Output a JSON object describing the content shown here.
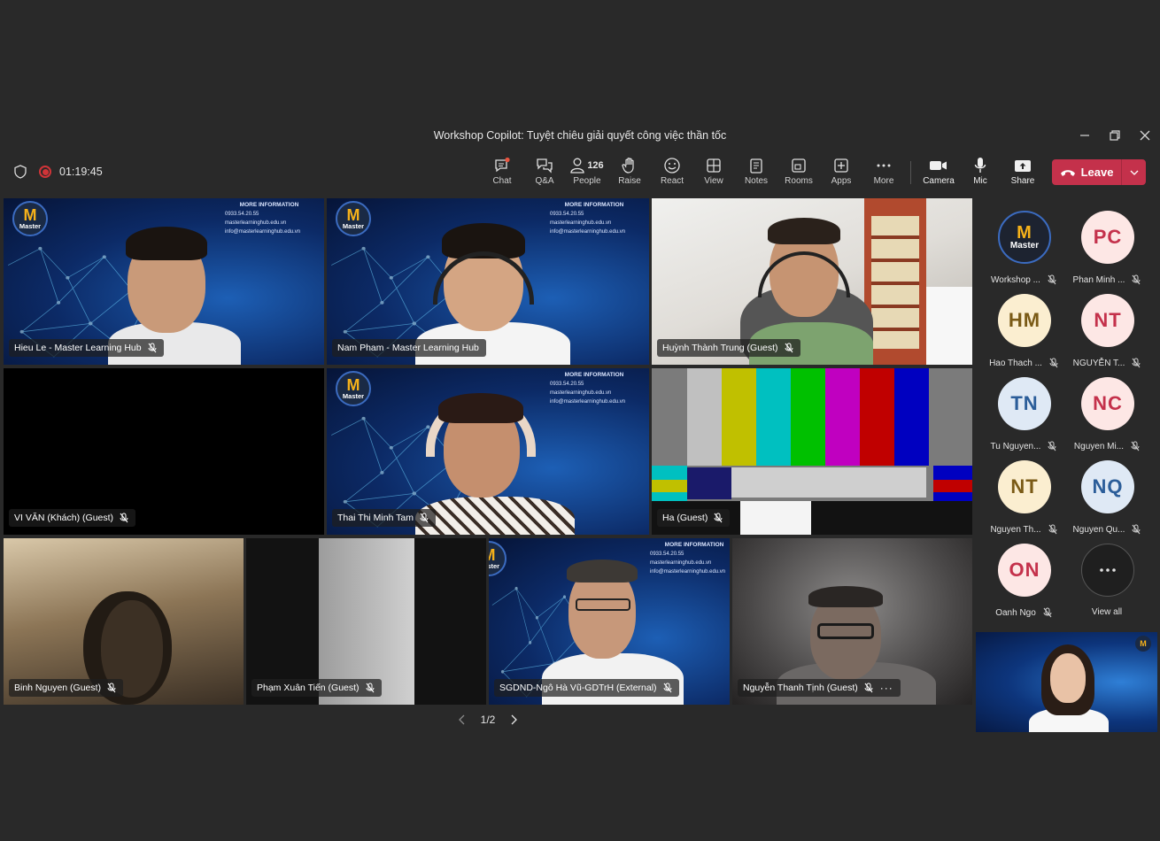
{
  "window": {
    "title": "Workshop Copilot: Tuyệt chiêu giải quyết công việc thần tốc"
  },
  "meeting": {
    "elapsed": "01:19:45"
  },
  "toolbar": {
    "chat": "Chat",
    "qa": "Q&A",
    "people": "People",
    "people_count": "126",
    "raise": "Raise",
    "react": "React",
    "view": "View",
    "notes": "Notes",
    "rooms": "Rooms",
    "apps": "Apps",
    "more": "More",
    "camera": "Camera",
    "mic": "Mic",
    "share": "Share",
    "leave": "Leave"
  },
  "background_card": {
    "title": "MORE INFORMATION",
    "phone": "0933.54.20.55",
    "web": "masterlearninghub.edu.vn",
    "email": "info@masterlearninghub.edu.vn",
    "logo_letter": "M",
    "logo_text": "Master"
  },
  "tiles": [
    {
      "name": "Hieu Le - Master Learning Hub"
    },
    {
      "name": "Nam Pham - Master Learning Hub"
    },
    {
      "name": "Huỳnh Thành Trung (Guest)"
    },
    {
      "name": "VI VĂN (Khách) (Guest)"
    },
    {
      "name": "Thai Thi Minh Tam"
    },
    {
      "name": "Ha (Guest)"
    },
    {
      "name": "Binh Nguyen (Guest)"
    },
    {
      "name": "Phạm Xuân Tiến (Guest)"
    },
    {
      "name": "SGDND-Ngô Hà Vũ-GDTrH (External)"
    },
    {
      "name": "Nguyễn Thanh Tịnh (Guest)"
    }
  ],
  "pager": {
    "label": "1/2"
  },
  "roster": [
    {
      "initials": "",
      "name": "Workshop ...",
      "bg": "#1d2330",
      "fg": "#ffffff"
    },
    {
      "initials": "PC",
      "name": "Phan Minh ...",
      "bg": "#fde7e5",
      "fg": "#c4314b"
    },
    {
      "initials": "HM",
      "name": "Hao Thach ...",
      "bg": "#fbeed0",
      "fg": "#7a5a16"
    },
    {
      "initials": "NT",
      "name": "NGUYỄN T...",
      "bg": "#fde7e5",
      "fg": "#c4314b"
    },
    {
      "initials": "TN",
      "name": "Tu Nguyen...",
      "bg": "#dfe9f5",
      "fg": "#2b5d99"
    },
    {
      "initials": "NC",
      "name": "Nguyen Mi...",
      "bg": "#fde7e5",
      "fg": "#c4314b"
    },
    {
      "initials": "NT",
      "name": "Nguyen Th...",
      "bg": "#fbeed0",
      "fg": "#7a5a16"
    },
    {
      "initials": "NQ",
      "name": "Nguyen Qu...",
      "bg": "#dfe9f5",
      "fg": "#2b5d99"
    },
    {
      "initials": "ON",
      "name": "Oanh Ngo",
      "bg": "#fde7e5",
      "fg": "#c4314b"
    }
  ],
  "view_all": "View all"
}
